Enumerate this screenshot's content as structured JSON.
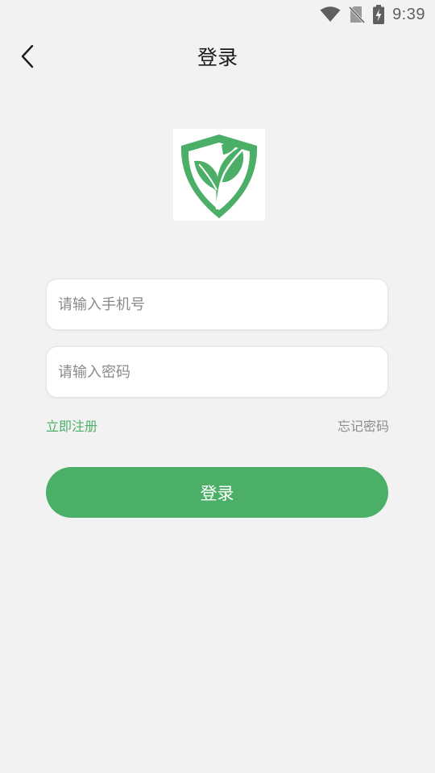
{
  "status_bar": {
    "time": "9:39",
    "icons": [
      "wifi-icon",
      "no-sim-icon",
      "battery-charging-icon"
    ]
  },
  "header": {
    "title": "登录",
    "back_icon": "chevron-left-icon"
  },
  "logo": {
    "icon": "shield-leaf-logo",
    "colors": {
      "primary": "#4caf67"
    }
  },
  "form": {
    "phone_placeholder": "请输入手机号",
    "password_placeholder": "请输入密码",
    "register_label": "立即注册",
    "forgot_label": "忘记密码",
    "login_label": "登录"
  },
  "colors": {
    "accent": "#4caf67",
    "background": "#f2f2f2",
    "muted_text": "#8c8c8c"
  }
}
